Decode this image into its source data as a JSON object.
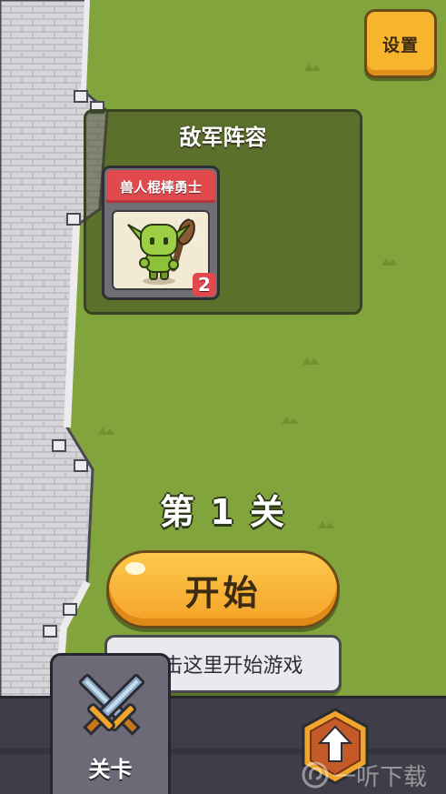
{
  "settings": {
    "label": "设置"
  },
  "enemy_panel": {
    "title": "敌军阵容",
    "units": [
      {
        "name": "兽人棍棒勇士",
        "count": "2",
        "portrait_icon": "goblin-club-warrior-icon"
      }
    ]
  },
  "level": {
    "label": "第 1 关"
  },
  "start_button": {
    "label": "开始"
  },
  "hint": {
    "text": "点击这里开始游戏"
  },
  "bottom_nav": {
    "tabs": [
      {
        "label": "关卡",
        "icon": "crossed-swords-icon",
        "active": true
      }
    ],
    "upgrade_icon": "upgrade-arrow-hexagon-icon"
  },
  "watermark": {
    "text": "一听下载"
  },
  "colors": {
    "grass": "#82a43c",
    "accent_orange": "#f4a226",
    "card_red": "#e04a4f",
    "nav_bg": "#3f3e48"
  }
}
